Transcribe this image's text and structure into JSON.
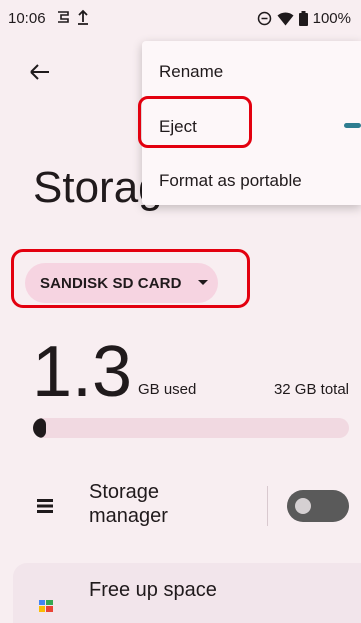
{
  "status_bar": {
    "time": "10:06",
    "battery": "100%",
    "icons": [
      "sync-icon",
      "upload-icon",
      "do-not-disturb-icon",
      "wifi-icon",
      "battery-icon"
    ]
  },
  "page": {
    "title": "Storage"
  },
  "storage_selector": {
    "label": "SANDISK SD CARD"
  },
  "usage": {
    "used_value": "1.3",
    "used_unit": "GB used",
    "total": "32 GB total",
    "used_fraction": 0.04
  },
  "storage_manager": {
    "label": "Storage manager",
    "enabled": false
  },
  "free_up": {
    "label": "Free up space"
  },
  "overflow_menu": {
    "items": [
      "Rename",
      "Eject",
      "Format as portable"
    ]
  },
  "colors": {
    "highlight": "#e3000f",
    "chip": "#f6d4e1",
    "background": "#f8eef1"
  }
}
